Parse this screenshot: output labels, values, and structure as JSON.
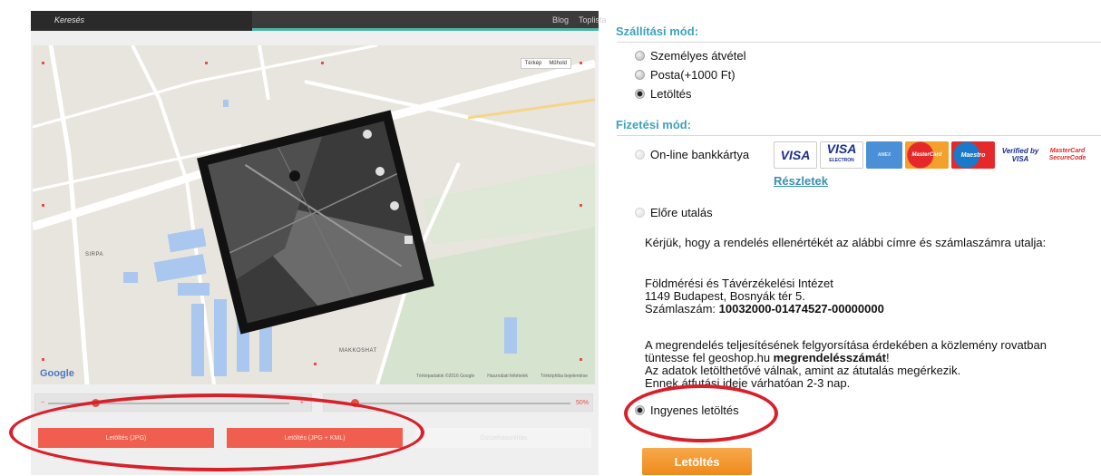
{
  "left_panel": {
    "brand": "Keresés",
    "nav": [
      "Blog",
      "Toplista"
    ],
    "map_type": [
      "Térkép",
      "Műhold"
    ],
    "google_logo": "Google",
    "attribution": [
      "Térképadatok ©2016 Google",
      "Használati feltételek",
      "Térképhiba bejelentése"
    ],
    "map_label": "MAKKOSHAT",
    "map_label_2": "SIRPA",
    "slider_percent": "50%",
    "buttons": [
      "Letöltés (JPG)",
      "Letöltés (JPG + KML)",
      "Összehasonlítás"
    ]
  },
  "shipping": {
    "title": "Szállítási mód:",
    "options": [
      {
        "label": "Személyes átvétel",
        "checked": false
      },
      {
        "label": "Posta(+1000 Ft)",
        "checked": false
      },
      {
        "label": "Letöltés",
        "checked": true
      }
    ]
  },
  "payment": {
    "title": "Fizetési mód:",
    "online_label": "On-line bankkártya",
    "cards": [
      "VISA",
      "VISA",
      "AMEX",
      "MasterCard",
      "Maestro",
      "Verified by VISA",
      "MasterCard SecureCode"
    ],
    "card_sublabel": "ELECTRON",
    "details_link": "Részletek",
    "transfer_label": "Előre utalás",
    "transfer_text_1": "Kérjük, hogy a rendelés ellenértékét az alábbi címre és számlaszámra utalja:",
    "address_line_1": "Földmérési és Távérzékelési Intézet",
    "address_line_2": "1149 Budapest, Bosnyák tér 5.",
    "account_label": "Számlaszám: ",
    "account_number": "10032000-01474527-00000000",
    "note_1a": "A megrendelés teljesítésének felgyorsítása érdekében a közlemény rovatban tüntesse fel geoshop.hu ",
    "note_1b": "megrendelésszámát",
    "note_1c": "!",
    "note_2": "Az adatok letölthetővé válnak, amint az átutalás megérkezik.",
    "note_3": "Ennek átfutási ideje várhatóan 2-3 nap.",
    "free_download_label": "Ingyenes letöltés",
    "free_download_checked": true
  },
  "download_button": "Letöltés",
  "colors": {
    "heading": "#3ea2bf",
    "button_orange": "#ee8a1b",
    "annotation_red": "#d8202a",
    "map_button_red": "#ef5e4e"
  }
}
